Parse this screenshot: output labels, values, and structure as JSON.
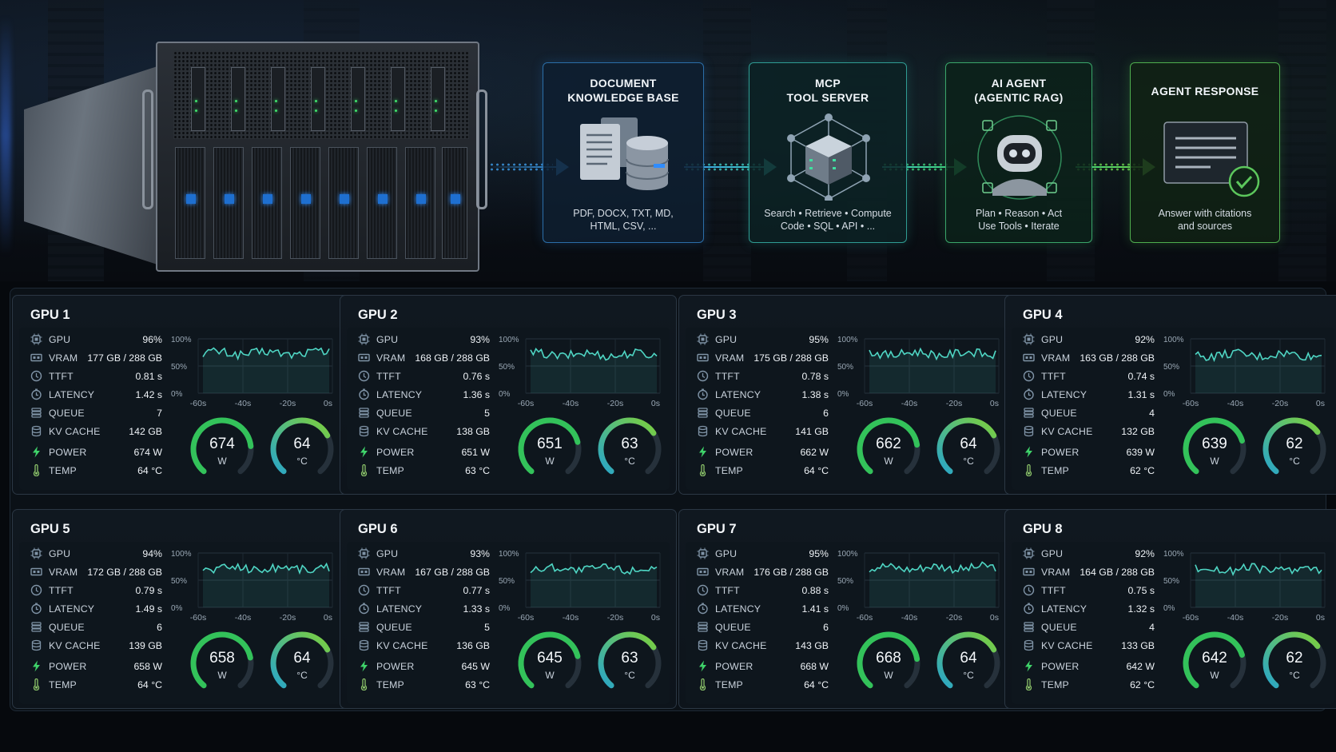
{
  "pipeline": {
    "stages": [
      {
        "id": "doc",
        "title": "DOCUMENT\nKNOWLEDGE BASE",
        "subtitle": "PDF, DOCX, TXT, MD,\nHTML, CSV, ...",
        "icon": "document-database-icon",
        "accent": "#2b6ea8"
      },
      {
        "id": "mcp",
        "title": "MCP\nTOOL SERVER",
        "subtitle": "Search • Retrieve • Compute\nCode • SQL • API • ...",
        "icon": "tool-server-cube-icon",
        "accent": "#2f9c93"
      },
      {
        "id": "ai",
        "title": "AI AGENT\n(AGENTIC RAG)",
        "subtitle": "Plan • Reason • Act\nUse Tools • Iterate",
        "icon": "robot-agent-icon",
        "accent": "#3aa66a"
      },
      {
        "id": "resp",
        "title": "AGENT RESPONSE",
        "subtitle": "Answer with citations\nand sources",
        "icon": "response-check-icon",
        "accent": "#4fae4f"
      }
    ]
  },
  "labels": {
    "gpu": "GPU",
    "vram": "VRAM",
    "ttft": "TTFT",
    "latency": "LATENCY",
    "queue": "QUEUE",
    "kv_cache": "KV CACHE",
    "power": "POWER",
    "temp": "TEMP",
    "y_ticks": [
      "100%",
      "50%",
      "0%"
    ],
    "x_ticks": [
      "-60s",
      "-40s",
      "-20s",
      "0s"
    ],
    "power_unit": "W",
    "temp_unit": "°C"
  },
  "colors": {
    "power_gauge": "#33c25a",
    "temp_gauge_start": "#2aa6c8",
    "temp_gauge_end": "#7ccf3d",
    "spark": "#4fd6c4"
  },
  "gpus": [
    {
      "name": "GPU 1",
      "gpu_util": "96%",
      "vram": "177 GB / 288 GB",
      "ttft": "0.81 s",
      "latency": "1.42 s",
      "queue": "7",
      "kv_cache": "142 GB",
      "power": "674 W",
      "temp": "64 °C",
      "power_value": "674",
      "temp_value": "64",
      "power_fraction": 0.8,
      "temp_fraction": 0.72
    },
    {
      "name": "GPU 2",
      "gpu_util": "93%",
      "vram": "168 GB / 288 GB",
      "ttft": "0.76 s",
      "latency": "1.36 s",
      "queue": "5",
      "kv_cache": "138 GB",
      "power": "651 W",
      "temp": "63 °C",
      "power_value": "651",
      "temp_value": "63",
      "power_fraction": 0.77,
      "temp_fraction": 0.7
    },
    {
      "name": "GPU 3",
      "gpu_util": "95%",
      "vram": "175 GB / 288 GB",
      "ttft": "0.78 s",
      "latency": "1.38 s",
      "queue": "6",
      "kv_cache": "141 GB",
      "power": "662 W",
      "temp": "64 °C",
      "power_value": "662",
      "temp_value": "64",
      "power_fraction": 0.79,
      "temp_fraction": 0.72
    },
    {
      "name": "GPU 4",
      "gpu_util": "92%",
      "vram": "163 GB / 288 GB",
      "ttft": "0.74 s",
      "latency": "1.31 s",
      "queue": "4",
      "kv_cache": "132 GB",
      "power": "639 W",
      "temp": "62 °C",
      "power_value": "639",
      "temp_value": "62",
      "power_fraction": 0.76,
      "temp_fraction": 0.69
    },
    {
      "name": "GPU 5",
      "gpu_util": "94%",
      "vram": "172 GB / 288 GB",
      "ttft": "0.79 s",
      "latency": "1.49 s",
      "queue": "6",
      "kv_cache": "139 GB",
      "power": "658 W",
      "temp": "64 °C",
      "power_value": "658",
      "temp_value": "64",
      "power_fraction": 0.78,
      "temp_fraction": 0.72
    },
    {
      "name": "GPU 6",
      "gpu_util": "93%",
      "vram": "167 GB / 288 GB",
      "ttft": "0.77 s",
      "latency": "1.33 s",
      "queue": "5",
      "kv_cache": "136 GB",
      "power": "645 W",
      "temp": "63 °C",
      "power_value": "645",
      "temp_value": "63",
      "power_fraction": 0.77,
      "temp_fraction": 0.7
    },
    {
      "name": "GPU 7",
      "gpu_util": "95%",
      "vram": "176 GB / 288 GB",
      "ttft": "0.88 s",
      "latency": "1.41 s",
      "queue": "6",
      "kv_cache": "143 GB",
      "power": "668 W",
      "temp": "64 °C",
      "power_value": "668",
      "temp_value": "64",
      "power_fraction": 0.79,
      "temp_fraction": 0.72
    },
    {
      "name": "GPU 8",
      "gpu_util": "92%",
      "vram": "164 GB / 288 GB",
      "ttft": "0.75 s",
      "latency": "1.32 s",
      "queue": "4",
      "kv_cache": "133 GB",
      "power": "642 W",
      "temp": "62 °C",
      "power_value": "642",
      "temp_value": "62",
      "power_fraction": 0.76,
      "temp_fraction": 0.69
    }
  ]
}
